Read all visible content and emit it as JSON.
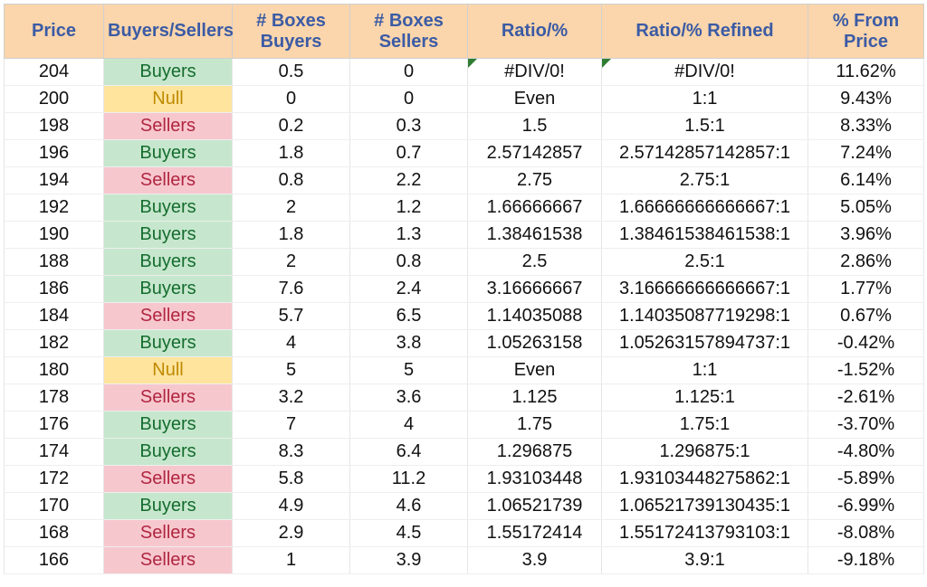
{
  "headers": {
    "price": "Price",
    "bs": "Buyers/Sellers",
    "bb": "# Boxes Buyers",
    "sb": "# Boxes Sellers",
    "ratio": "Ratio/%",
    "refined": "Ratio/% Refined",
    "pfp": "% From Price"
  },
  "rows": [
    {
      "price": "204",
      "bs": "Buyers",
      "bb": "0.5",
      "sb": "0",
      "ratio": "#DIV/0!",
      "refined": "#DIV/0!",
      "pfp": "11.62%",
      "err": true
    },
    {
      "price": "200",
      "bs": "Null",
      "bb": "0",
      "sb": "0",
      "ratio": "Even",
      "refined": "1:1",
      "pfp": "9.43%"
    },
    {
      "price": "198",
      "bs": "Sellers",
      "bb": "0.2",
      "sb": "0.3",
      "ratio": "1.5",
      "refined": "1.5:1",
      "pfp": "8.33%"
    },
    {
      "price": "196",
      "bs": "Buyers",
      "bb": "1.8",
      "sb": "0.7",
      "ratio": "2.57142857",
      "refined": "2.57142857142857:1",
      "pfp": "7.24%"
    },
    {
      "price": "194",
      "bs": "Sellers",
      "bb": "0.8",
      "sb": "2.2",
      "ratio": "2.75",
      "refined": "2.75:1",
      "pfp": "6.14%"
    },
    {
      "price": "192",
      "bs": "Buyers",
      "bb": "2",
      "sb": "1.2",
      "ratio": "1.66666667",
      "refined": "1.66666666666667:1",
      "pfp": "5.05%"
    },
    {
      "price": "190",
      "bs": "Buyers",
      "bb": "1.8",
      "sb": "1.3",
      "ratio": "1.38461538",
      "refined": "1.38461538461538:1",
      "pfp": "3.96%"
    },
    {
      "price": "188",
      "bs": "Buyers",
      "bb": "2",
      "sb": "0.8",
      "ratio": "2.5",
      "refined": "2.5:1",
      "pfp": "2.86%"
    },
    {
      "price": "186",
      "bs": "Buyers",
      "bb": "7.6",
      "sb": "2.4",
      "ratio": "3.16666667",
      "refined": "3.16666666666667:1",
      "pfp": "1.77%"
    },
    {
      "price": "184",
      "bs": "Sellers",
      "bb": "5.7",
      "sb": "6.5",
      "ratio": "1.14035088",
      "refined": "1.14035087719298:1",
      "pfp": "0.67%"
    },
    {
      "price": "182",
      "bs": "Buyers",
      "bb": "4",
      "sb": "3.8",
      "ratio": "1.05263158",
      "refined": "1.05263157894737:1",
      "pfp": "-0.42%"
    },
    {
      "price": "180",
      "bs": "Null",
      "bb": "5",
      "sb": "5",
      "ratio": "Even",
      "refined": "1:1",
      "pfp": "-1.52%"
    },
    {
      "price": "178",
      "bs": "Sellers",
      "bb": "3.2",
      "sb": "3.6",
      "ratio": "1.125",
      "refined": "1.125:1",
      "pfp": "-2.61%"
    },
    {
      "price": "176",
      "bs": "Buyers",
      "bb": "7",
      "sb": "4",
      "ratio": "1.75",
      "refined": "1.75:1",
      "pfp": "-3.70%"
    },
    {
      "price": "174",
      "bs": "Buyers",
      "bb": "8.3",
      "sb": "6.4",
      "ratio": "1.296875",
      "refined": "1.296875:1",
      "pfp": "-4.80%"
    },
    {
      "price": "172",
      "bs": "Sellers",
      "bb": "5.8",
      "sb": "11.2",
      "ratio": "1.93103448",
      "refined": "1.93103448275862:1",
      "pfp": "-5.89%"
    },
    {
      "price": "170",
      "bs": "Buyers",
      "bb": "4.9",
      "sb": "4.6",
      "ratio": "1.06521739",
      "refined": "1.06521739130435:1",
      "pfp": "-6.99%"
    },
    {
      "price": "168",
      "bs": "Sellers",
      "bb": "2.9",
      "sb": "4.5",
      "ratio": "1.55172414",
      "refined": "1.55172413793103:1",
      "pfp": "-8.08%"
    },
    {
      "price": "166",
      "bs": "Sellers",
      "bb": "1",
      "sb": "3.9",
      "ratio": "3.9",
      "refined": "3.9:1",
      "pfp": "-9.18%"
    }
  ]
}
